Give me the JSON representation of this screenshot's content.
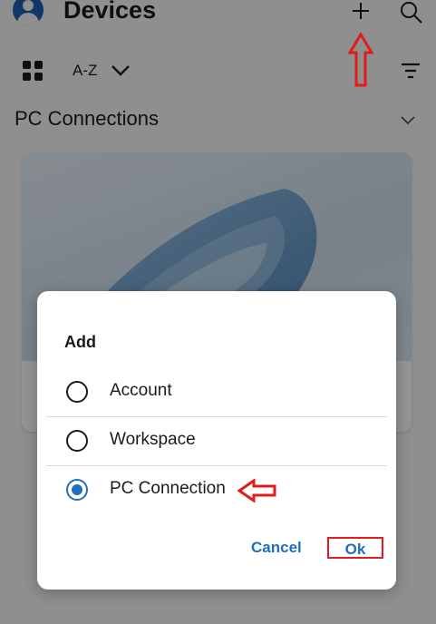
{
  "header": {
    "title": "Devices",
    "avatar_icon": "person-icon",
    "add_icon": "plus-icon",
    "search_icon": "search-icon"
  },
  "toolbar": {
    "view_icon": "grid-icon",
    "sort_label": "A-Z",
    "sort_icon": "chevron-down-icon",
    "filter_icon": "filter-icon"
  },
  "section": {
    "title": "PC Connections",
    "toggle_icon": "chevron-down-icon"
  },
  "dialog": {
    "title": "Add",
    "options": [
      {
        "label": "Account",
        "selected": false
      },
      {
        "label": "Workspace",
        "selected": false
      },
      {
        "label": "PC Connection",
        "selected": true
      }
    ],
    "cancel_label": "Cancel",
    "ok_label": "Ok"
  },
  "colors": {
    "accent": "#1f6fbd",
    "annotation": "#e21b1b",
    "scrim": "rgba(0,0,0,0.42)"
  }
}
